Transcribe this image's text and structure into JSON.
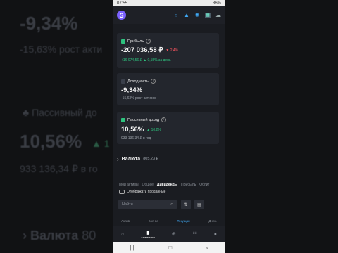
{
  "background": {
    "yield_value": "-9,34%",
    "yield_sub": "-15,63% рост акти",
    "passive_label": "Пассивный до",
    "passive_value": "10,56%",
    "passive_change": "▲ 1",
    "passive_sub": "933 136,34 ₽ в го",
    "valuta_label": "Валюта",
    "valuta_value": "80"
  },
  "status_bar": {
    "time": "07:55",
    "battery": "86%"
  },
  "app": {
    "logo_letter": "S",
    "accent": "#7b61ff"
  },
  "profit_card": {
    "label": "Прибыль",
    "value": "-207 036,58 ₽",
    "change": "▼ 2,4%",
    "day_line": "+16 974,56 ₽ ▲ 0,15% за день"
  },
  "yield_card": {
    "label": "Доходность",
    "value": "-9,34%",
    "sub": "-15,63% рост активов"
  },
  "passive_card": {
    "label": "Пассивный доход",
    "value": "10,56%",
    "change": "▲ 10,2%",
    "sub": "933 136,34 ₽ в год"
  },
  "valuta": {
    "label": "Валюта",
    "value": "805,23 ₽"
  },
  "tabs": [
    "Мои активы",
    "Общее",
    "Дивиденды",
    "Прибыль",
    "Облиг"
  ],
  "active_tab_index": 2,
  "toggle_label": "Отображать проданные",
  "search_placeholder": "Найти...",
  "columns": [
    "Актив",
    "Кол-во",
    "Текущая",
    "Днев."
  ],
  "bottom_nav": [
    {
      "icon": "home-icon",
      "label": ""
    },
    {
      "icon": "analytics-icon",
      "label": "Аналитика"
    },
    {
      "icon": "plus-icon",
      "label": ""
    },
    {
      "icon": "discover-icon",
      "label": ""
    },
    {
      "icon": "profile-icon",
      "label": ""
    }
  ]
}
